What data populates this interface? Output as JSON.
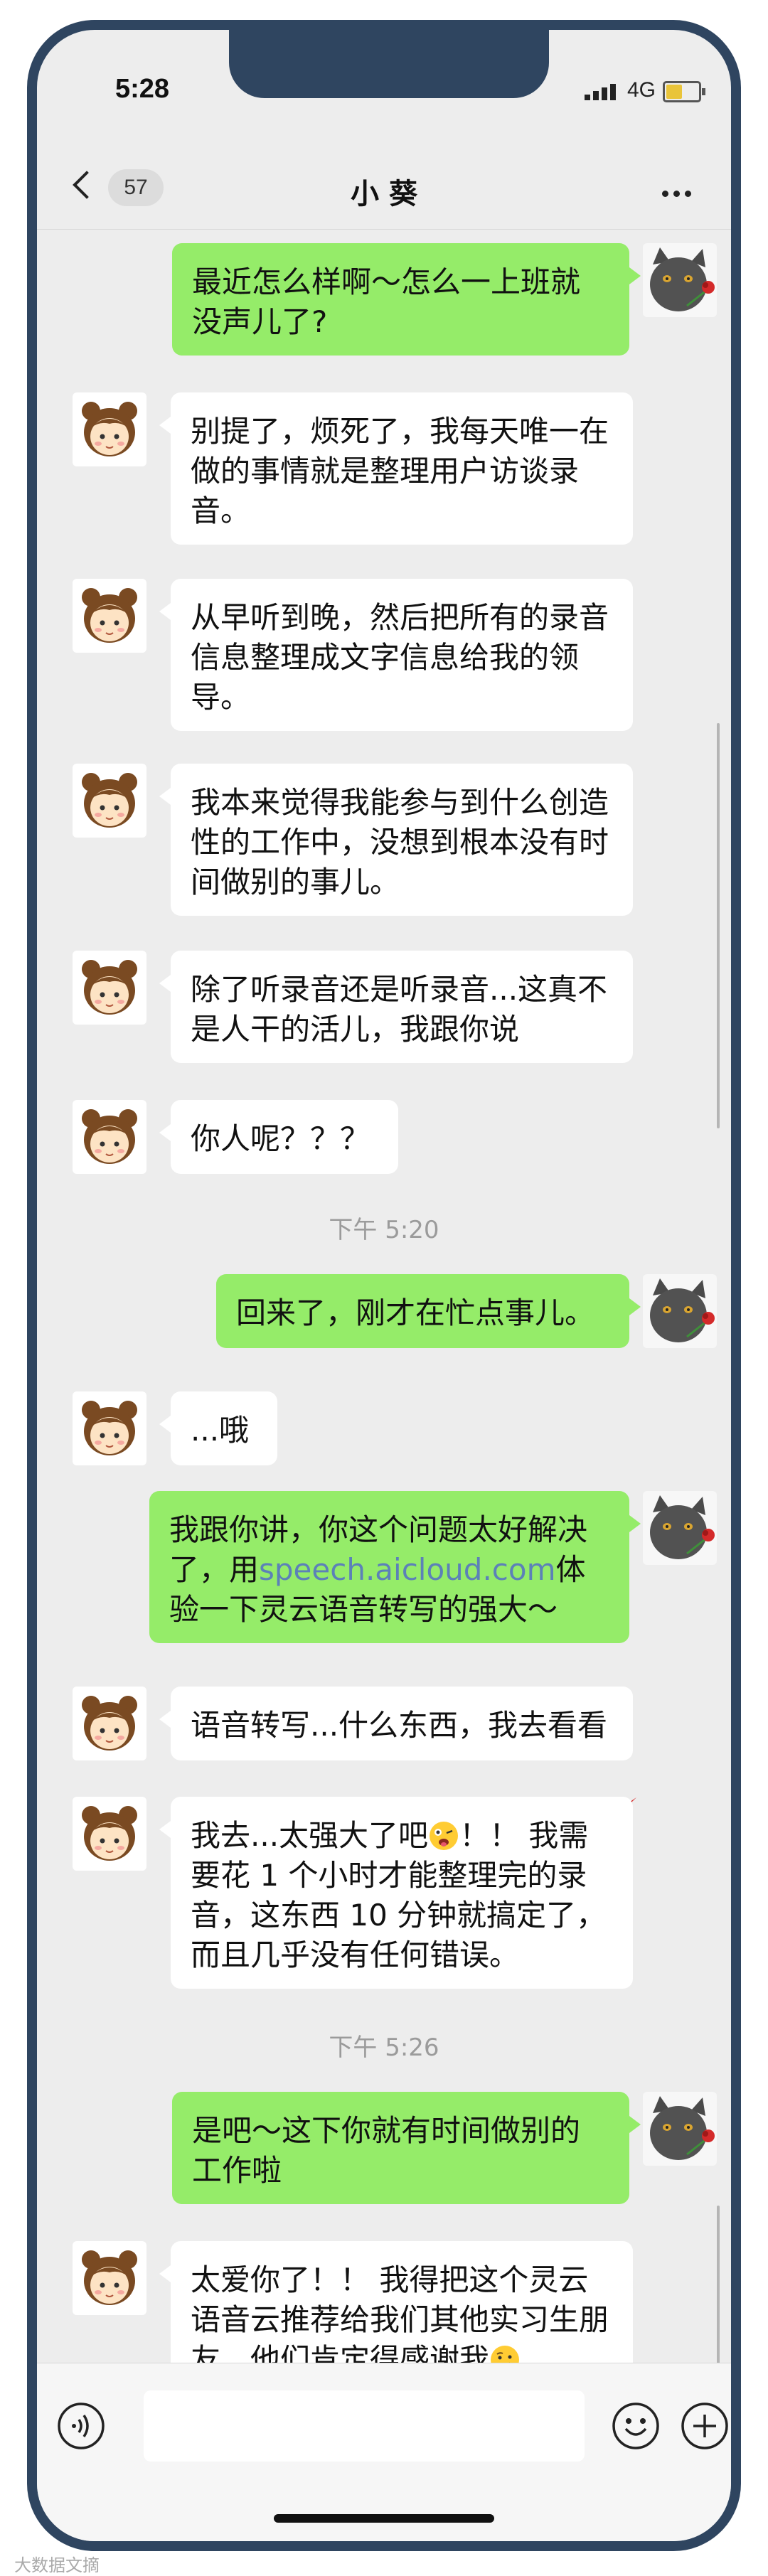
{
  "status": {
    "time": "5:28",
    "network": "4G"
  },
  "nav": {
    "unread_count": "57",
    "title": "小 葵"
  },
  "messages": [
    {
      "side": "right",
      "text": "最近怎么样啊～怎么一上班就没声儿了?"
    },
    {
      "side": "left",
      "text": "别提了，烦死了，我每天唯一在做的事情就是整理用户访谈录音。"
    },
    {
      "side": "left",
      "text": "从早听到晚，然后把所有的录音信息整理成文字信息给我的领导。"
    },
    {
      "side": "left",
      "text": "我本来觉得我能参与到什么创造性的工作中，没想到根本没有时间做别的事儿。"
    },
    {
      "side": "left",
      "text": "除了听录音还是听录音...这真不是人干的活儿，我跟你说"
    },
    {
      "side": "left",
      "text": "你人呢？？？"
    },
    {
      "side": "time",
      "text": "下午 5:20"
    },
    {
      "side": "right",
      "text": "回来了，刚才在忙点事儿。"
    },
    {
      "side": "left",
      "text": "...哦"
    },
    {
      "side": "right",
      "text_a": "我跟你讲，你这个问题太好解决了，用",
      "link": "speech.aicloud.com",
      "text_b": "体验一下灵云语音转写的强大～"
    },
    {
      "side": "left",
      "text": "语音转写...什么东西，我去看看"
    },
    {
      "side": "left",
      "text_a": "我去...太强大了吧",
      "text_b": "！！ 我需要花 1 个小时才能整理完的录音，这东西 10 分钟就搞定了，而且几乎没有任何错误。",
      "emoji": "crazy-face"
    },
    {
      "side": "time",
      "text": "下午 5:26"
    },
    {
      "side": "right",
      "text": "是吧～这下你就有时间做别的工作啦"
    },
    {
      "side": "left",
      "text": "太爱你了！！ 我得把这个灵云语音云推荐给我们其他实习生朋友，他们肯定得感谢我",
      "emoji": "thinking-face"
    }
  ],
  "input": {
    "placeholder": ""
  },
  "watermark": "大数据文摘",
  "colors": {
    "frame": "#2f4560",
    "bubble_right": "#95ec69",
    "bubble_left": "#ffffff",
    "background": "#ededed",
    "link": "#5c81b8"
  }
}
